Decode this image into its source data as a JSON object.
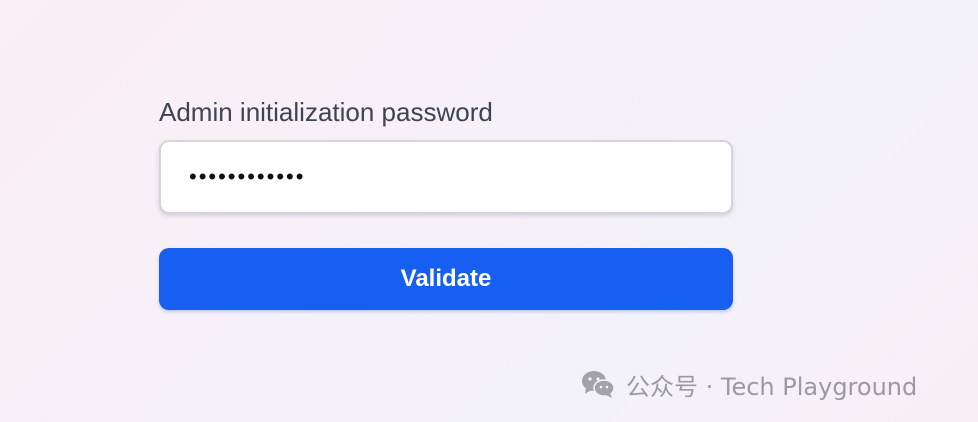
{
  "form": {
    "label": "Admin initialization password",
    "password_value": "••••••••••••",
    "validate_label": "Validate"
  },
  "watermark": {
    "text": "公众号 · Tech Playground",
    "icon": "wechat-icon"
  },
  "colors": {
    "primary_button": "#175ff0",
    "label_text": "#3d4452",
    "watermark_text": "#9a9aa2"
  }
}
